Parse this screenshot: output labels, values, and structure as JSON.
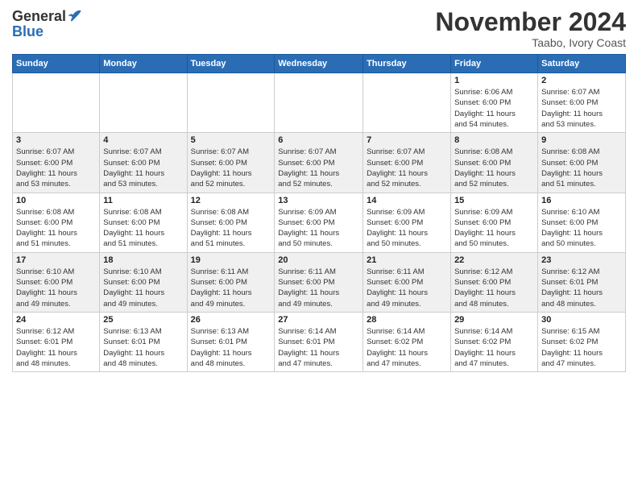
{
  "header": {
    "logo_general": "General",
    "logo_blue": "Blue",
    "month_title": "November 2024",
    "location": "Taabo, Ivory Coast"
  },
  "days_of_week": [
    "Sunday",
    "Monday",
    "Tuesday",
    "Wednesday",
    "Thursday",
    "Friday",
    "Saturday"
  ],
  "weeks": [
    [
      {
        "day": "",
        "info": ""
      },
      {
        "day": "",
        "info": ""
      },
      {
        "day": "",
        "info": ""
      },
      {
        "day": "",
        "info": ""
      },
      {
        "day": "",
        "info": ""
      },
      {
        "day": "1",
        "info": "Sunrise: 6:06 AM\nSunset: 6:00 PM\nDaylight: 11 hours\nand 54 minutes."
      },
      {
        "day": "2",
        "info": "Sunrise: 6:07 AM\nSunset: 6:00 PM\nDaylight: 11 hours\nand 53 minutes."
      }
    ],
    [
      {
        "day": "3",
        "info": "Sunrise: 6:07 AM\nSunset: 6:00 PM\nDaylight: 11 hours\nand 53 minutes."
      },
      {
        "day": "4",
        "info": "Sunrise: 6:07 AM\nSunset: 6:00 PM\nDaylight: 11 hours\nand 53 minutes."
      },
      {
        "day": "5",
        "info": "Sunrise: 6:07 AM\nSunset: 6:00 PM\nDaylight: 11 hours\nand 52 minutes."
      },
      {
        "day": "6",
        "info": "Sunrise: 6:07 AM\nSunset: 6:00 PM\nDaylight: 11 hours\nand 52 minutes."
      },
      {
        "day": "7",
        "info": "Sunrise: 6:07 AM\nSunset: 6:00 PM\nDaylight: 11 hours\nand 52 minutes."
      },
      {
        "day": "8",
        "info": "Sunrise: 6:08 AM\nSunset: 6:00 PM\nDaylight: 11 hours\nand 52 minutes."
      },
      {
        "day": "9",
        "info": "Sunrise: 6:08 AM\nSunset: 6:00 PM\nDaylight: 11 hours\nand 51 minutes."
      }
    ],
    [
      {
        "day": "10",
        "info": "Sunrise: 6:08 AM\nSunset: 6:00 PM\nDaylight: 11 hours\nand 51 minutes."
      },
      {
        "day": "11",
        "info": "Sunrise: 6:08 AM\nSunset: 6:00 PM\nDaylight: 11 hours\nand 51 minutes."
      },
      {
        "day": "12",
        "info": "Sunrise: 6:08 AM\nSunset: 6:00 PM\nDaylight: 11 hours\nand 51 minutes."
      },
      {
        "day": "13",
        "info": "Sunrise: 6:09 AM\nSunset: 6:00 PM\nDaylight: 11 hours\nand 50 minutes."
      },
      {
        "day": "14",
        "info": "Sunrise: 6:09 AM\nSunset: 6:00 PM\nDaylight: 11 hours\nand 50 minutes."
      },
      {
        "day": "15",
        "info": "Sunrise: 6:09 AM\nSunset: 6:00 PM\nDaylight: 11 hours\nand 50 minutes."
      },
      {
        "day": "16",
        "info": "Sunrise: 6:10 AM\nSunset: 6:00 PM\nDaylight: 11 hours\nand 50 minutes."
      }
    ],
    [
      {
        "day": "17",
        "info": "Sunrise: 6:10 AM\nSunset: 6:00 PM\nDaylight: 11 hours\nand 49 minutes."
      },
      {
        "day": "18",
        "info": "Sunrise: 6:10 AM\nSunset: 6:00 PM\nDaylight: 11 hours\nand 49 minutes."
      },
      {
        "day": "19",
        "info": "Sunrise: 6:11 AM\nSunset: 6:00 PM\nDaylight: 11 hours\nand 49 minutes."
      },
      {
        "day": "20",
        "info": "Sunrise: 6:11 AM\nSunset: 6:00 PM\nDaylight: 11 hours\nand 49 minutes."
      },
      {
        "day": "21",
        "info": "Sunrise: 6:11 AM\nSunset: 6:00 PM\nDaylight: 11 hours\nand 49 minutes."
      },
      {
        "day": "22",
        "info": "Sunrise: 6:12 AM\nSunset: 6:00 PM\nDaylight: 11 hours\nand 48 minutes."
      },
      {
        "day": "23",
        "info": "Sunrise: 6:12 AM\nSunset: 6:01 PM\nDaylight: 11 hours\nand 48 minutes."
      }
    ],
    [
      {
        "day": "24",
        "info": "Sunrise: 6:12 AM\nSunset: 6:01 PM\nDaylight: 11 hours\nand 48 minutes."
      },
      {
        "day": "25",
        "info": "Sunrise: 6:13 AM\nSunset: 6:01 PM\nDaylight: 11 hours\nand 48 minutes."
      },
      {
        "day": "26",
        "info": "Sunrise: 6:13 AM\nSunset: 6:01 PM\nDaylight: 11 hours\nand 48 minutes."
      },
      {
        "day": "27",
        "info": "Sunrise: 6:14 AM\nSunset: 6:01 PM\nDaylight: 11 hours\nand 47 minutes."
      },
      {
        "day": "28",
        "info": "Sunrise: 6:14 AM\nSunset: 6:02 PM\nDaylight: 11 hours\nand 47 minutes."
      },
      {
        "day": "29",
        "info": "Sunrise: 6:14 AM\nSunset: 6:02 PM\nDaylight: 11 hours\nand 47 minutes."
      },
      {
        "day": "30",
        "info": "Sunrise: 6:15 AM\nSunset: 6:02 PM\nDaylight: 11 hours\nand 47 minutes."
      }
    ]
  ]
}
